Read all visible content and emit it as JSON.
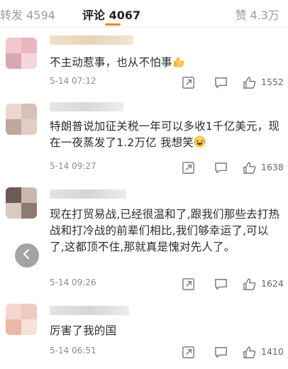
{
  "tabs": {
    "repost": {
      "label": "转发",
      "count": "4594"
    },
    "comment": {
      "label": "评论",
      "count": "4067"
    },
    "like": {
      "label": "赞",
      "count": "4.3万"
    }
  },
  "colors": {
    "accent": "#ff8200"
  },
  "comments": [
    {
      "text": "不主动惹事，也从不怕事",
      "emoji": "thumbs-up",
      "time": "5-14 07:12",
      "likes": "1552"
    },
    {
      "text": "特朗普说加征关税一年可以多收1千亿美元，现在一夜蒸发了1.2万亿 我想笑",
      "emoji": "laughing-crying",
      "time": "5-14 09:27",
      "likes": "1638"
    },
    {
      "text": "现在打贸易战,已经很温和了,跟我们那些去打热战和打冷战的前辈们相比,我们够幸运了,可以了,这都顶不住,那就真是愧对先人了。",
      "time": "5-14 09:26",
      "likes": "1624"
    },
    {
      "text": "厉害了我的国",
      "time": "5-14 06:51",
      "likes": "1410"
    }
  ]
}
